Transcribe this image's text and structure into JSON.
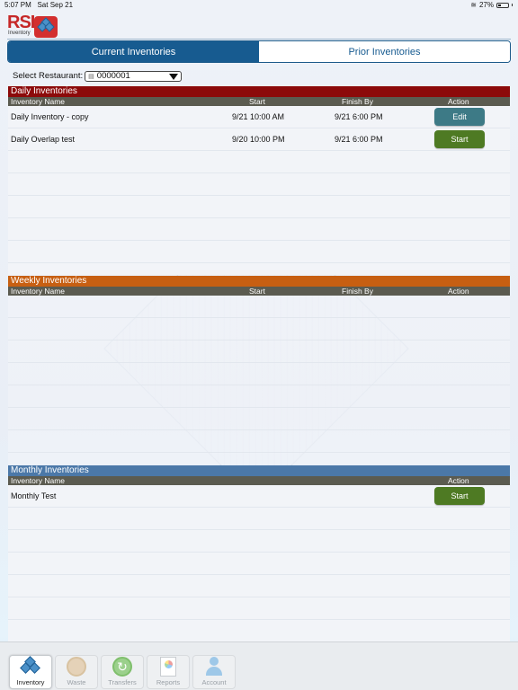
{
  "status_bar": {
    "time": "5:07 PM",
    "date": "Sat Sep 21",
    "battery": "27%"
  },
  "logo": {
    "text": "RSI",
    "subtext": "Inventory"
  },
  "tabs": [
    {
      "label": "Current Inventories",
      "active": true
    },
    {
      "label": "Prior Inventories",
      "active": false
    }
  ],
  "restaurant_select": {
    "label": "Select Restaurant:",
    "value": "0000001"
  },
  "columns": {
    "name": "Inventory Name",
    "start": "Start",
    "finish": "Finish By",
    "action": "Action"
  },
  "sections": {
    "daily": {
      "title": "Daily Inventories",
      "color": "#8c0a0a",
      "rows": [
        {
          "name": "Daily Inventory - copy",
          "start": "9/21 10:00 AM",
          "finish": "9/21 6:00 PM",
          "action": "Edit"
        },
        {
          "name": "Daily Overlap test",
          "start": "9/20 10:00 PM",
          "finish": "9/21 6:00 PM",
          "action": "Start"
        }
      ]
    },
    "weekly": {
      "title": "Weekly Inventories",
      "color": "#c75f12",
      "rows": []
    },
    "monthly": {
      "title": "Monthly Inventories",
      "color": "#4b78a8",
      "rows": [
        {
          "name": "Monthly Test",
          "action": "Start"
        }
      ]
    }
  },
  "bottom_tabs": [
    {
      "label": "Inventory",
      "icon": "inventory-icon",
      "active": true
    },
    {
      "label": "Waste",
      "icon": "waste-icon",
      "active": false
    },
    {
      "label": "Transfers",
      "icon": "transfers-icon",
      "active": false
    },
    {
      "label": "Reports",
      "icon": "reports-icon",
      "active": false
    },
    {
      "label": "Account",
      "icon": "account-icon",
      "active": false
    }
  ]
}
